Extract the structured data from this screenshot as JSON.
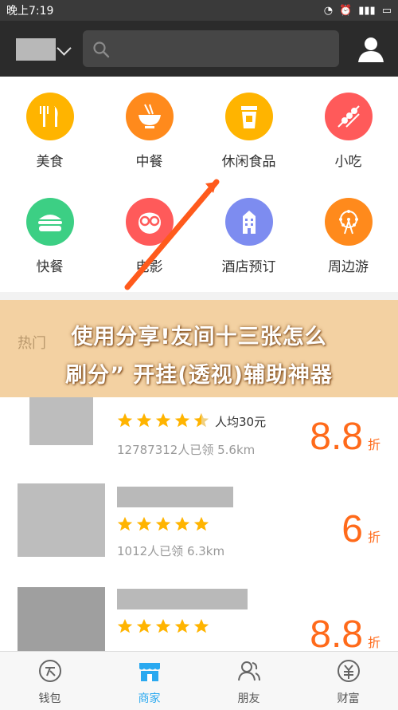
{
  "status_bar": {
    "time": "晚上7:19"
  },
  "header": {
    "search_placeholder": ""
  },
  "categories": [
    {
      "label": "美食",
      "icon": "fork-knife-icon",
      "color": "#ffb400"
    },
    {
      "label": "中餐",
      "icon": "bowl-icon",
      "color": "#ff8a1c"
    },
    {
      "label": "休闲食品",
      "icon": "cup-icon",
      "color": "#ffb400"
    },
    {
      "label": "小吃",
      "icon": "skewer-icon",
      "color": "#ff5a5a"
    },
    {
      "label": "快餐",
      "icon": "burger-icon",
      "color": "#3ccf84"
    },
    {
      "label": "电影",
      "icon": "glasses-face-icon",
      "color": "#ff5a5a"
    },
    {
      "label": "酒店预订",
      "icon": "building-icon",
      "color": "#7d8cf0"
    },
    {
      "label": "周边游",
      "icon": "ferris-wheel-icon",
      "color": "#ff8a1c"
    }
  ],
  "banner": {
    "line1": "使用分享!友间十三张怎么",
    "line2": "刷分” 开挂(透视)辅助神器",
    "hidden_section_label": "热门"
  },
  "deals": [
    {
      "rating": 4.5,
      "avg_price": "人均30元",
      "meta": "12787312人已领 5.6km",
      "discount": "8.8",
      "unit": "折"
    },
    {
      "rating": 5,
      "avg_price": "",
      "meta": "1012人已领 6.3km",
      "discount": "6",
      "unit": "折"
    },
    {
      "rating": 5,
      "avg_price": "",
      "meta": "",
      "discount": "8.8",
      "unit": "折"
    }
  ],
  "bottom_nav": [
    {
      "label": "钱包",
      "icon": "wallet-icon",
      "active": false
    },
    {
      "label": "商家",
      "icon": "store-icon",
      "active": true
    },
    {
      "label": "朋友",
      "icon": "friends-icon",
      "active": false
    },
    {
      "label": "财富",
      "icon": "wealth-icon",
      "active": false
    }
  ],
  "colors": {
    "accent": "#ff6a1a",
    "active_tab": "#2aa9f0",
    "star": "#ffb400"
  }
}
